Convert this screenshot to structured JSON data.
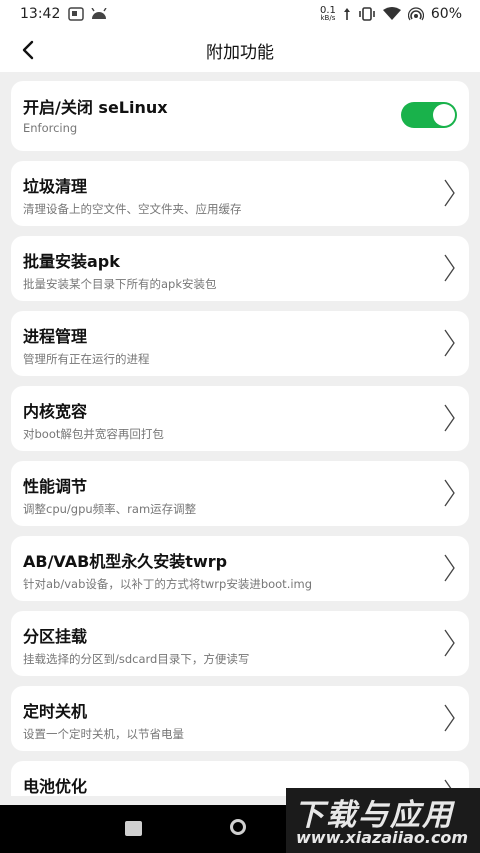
{
  "status_bar": {
    "time": "13:42",
    "net_speed_value": "0.1",
    "net_speed_unit": "kB/s",
    "battery": "60%"
  },
  "app_bar": {
    "title": "附加功能",
    "back_icon": "chevron-left-icon"
  },
  "selinux": {
    "title": "开启/关闭 seLinux",
    "subtitle": "Enforcing",
    "toggle_on": true,
    "toggle_color": "#19b24b"
  },
  "items": [
    {
      "title": "垃圾清理",
      "subtitle": "清理设备上的空文件、空文件夹、应用缓存"
    },
    {
      "title": "批量安装apk",
      "subtitle": "批量安装某个目录下所有的apk安装包"
    },
    {
      "title": "进程管理",
      "subtitle": "管理所有正在运行的进程"
    },
    {
      "title": "内核宽容",
      "subtitle": "对boot解包并宽容再回打包"
    },
    {
      "title": "性能调节",
      "subtitle": "调整cpu/gpu频率、ram运存调整"
    },
    {
      "title": "AB/VAB机型永久安装twrp",
      "subtitle": "针对ab/vab设备，以补丁的方式将twrp安装进boot.img"
    },
    {
      "title": "分区挂载",
      "subtitle": "挂载选择的分区到/sdcard目录下，方便读写"
    },
    {
      "title": "定时关机",
      "subtitle": "设置一个定时关机，以节省电量"
    },
    {
      "title": "电池优化",
      "subtitle": ""
    }
  ],
  "watermark": {
    "line1": "下载与应用",
    "line2": "www.xiazaiiao.com"
  }
}
